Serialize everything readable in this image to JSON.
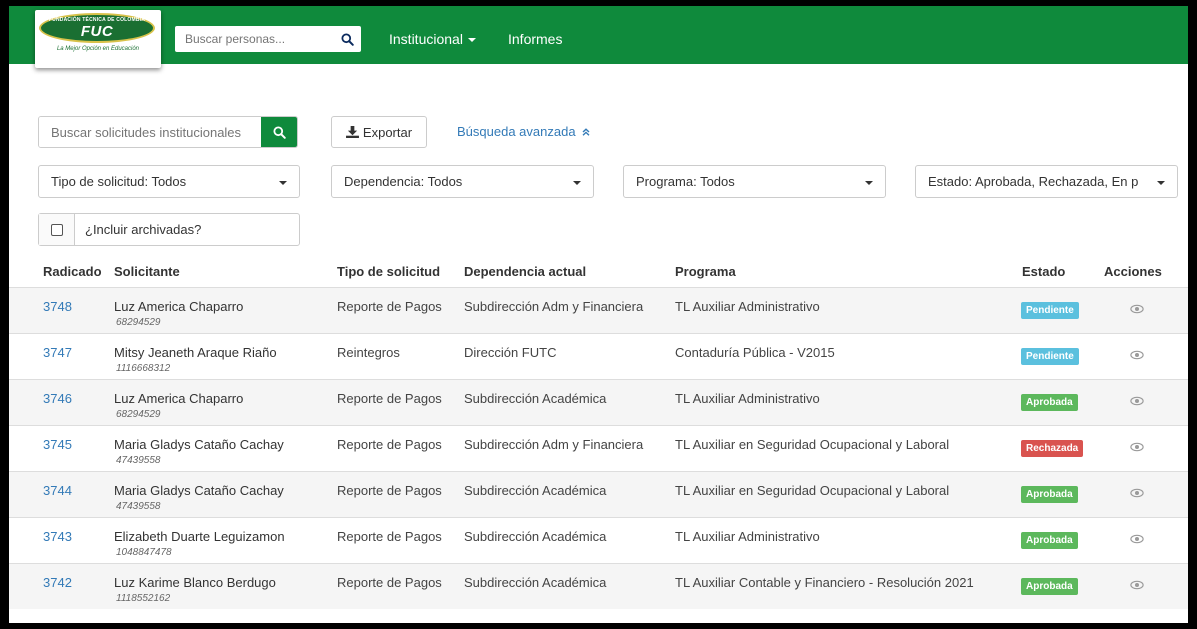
{
  "logo": {
    "ring_text": "FUNDACIÓN TÉCNICA DE COLOMBIA",
    "mark": "FUC",
    "tagline": "La Mejor Opción en Educación"
  },
  "nav": {
    "search_placeholder": "Buscar personas...",
    "items": [
      "Institucional",
      "Informes"
    ]
  },
  "filters": {
    "search_placeholder": "Buscar solicitudes institucionales",
    "export_label": "Exportar",
    "advanced_label": "Búsqueda avanzada",
    "tipo": "Tipo de solicitud: Todos",
    "dependencia": "Dependencia: Todos",
    "programa": "Programa: Todos",
    "estado": "Estado: Aprobada, Rechazada, En p",
    "archived_label": "¿Incluir archivadas?"
  },
  "table": {
    "headers": [
      "Radicado",
      "Solicitante",
      "Tipo de solicitud",
      "Dependencia actual",
      "Programa",
      "Estado",
      "Acciones"
    ],
    "rows": [
      {
        "radicado": "3748",
        "name": "Luz America Chaparro",
        "doc": "68294529",
        "tipo": "Reporte de Pagos",
        "dependencia": "Subdirección Adm y Financiera",
        "programa": "TL Auxiliar Administrativo",
        "estado": "Pendiente"
      },
      {
        "radicado": "3747",
        "name": "Mitsy Jeaneth Araque Riaño",
        "doc": "1116668312",
        "tipo": "Reintegros",
        "dependencia": "Dirección FUTC",
        "programa": "Contaduría Pública - V2015",
        "estado": "Pendiente"
      },
      {
        "radicado": "3746",
        "name": "Luz America Chaparro",
        "doc": "68294529",
        "tipo": "Reporte de Pagos",
        "dependencia": "Subdirección Académica",
        "programa": "TL Auxiliar Administrativo",
        "estado": "Aprobada"
      },
      {
        "radicado": "3745",
        "name": "Maria Gladys Cataño Cachay",
        "doc": "47439558",
        "tipo": "Reporte de Pagos",
        "dependencia": "Subdirección Adm y Financiera",
        "programa": "TL Auxiliar en Seguridad Ocupacional y Laboral",
        "estado": "Rechazada"
      },
      {
        "radicado": "3744",
        "name": "Maria Gladys Cataño Cachay",
        "doc": "47439558",
        "tipo": "Reporte de Pagos",
        "dependencia": "Subdirección Académica",
        "programa": "TL Auxiliar en Seguridad Ocupacional y Laboral",
        "estado": "Aprobada"
      },
      {
        "radicado": "3743",
        "name": "Elizabeth Duarte Leguizamon",
        "doc": "1048847478",
        "tipo": "Reporte de Pagos",
        "dependencia": "Subdirección Académica",
        "programa": "TL Auxiliar Administrativo",
        "estado": "Aprobada"
      },
      {
        "radicado": "3742",
        "name": "Luz Karime Blanco Berdugo",
        "doc": "1118552162",
        "tipo": "Reporte de Pagos",
        "dependencia": "Subdirección Académica",
        "programa": "TL Auxiliar Contable y Financiero - Resolución 2021",
        "estado": "Aprobada"
      }
    ]
  },
  "colors": {
    "brand_green": "#0f8a3c",
    "pendiente": "#5bc0de",
    "aprobada": "#5cb85c",
    "rechazada": "#d9534f",
    "link": "#337ab7"
  }
}
